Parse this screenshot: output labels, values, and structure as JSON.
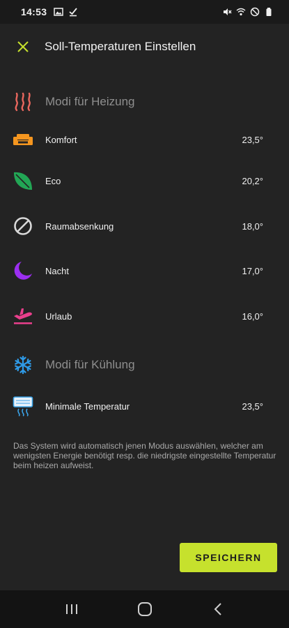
{
  "status_bar": {
    "time": "14:53",
    "left_icons": [
      "image-icon",
      "download-done-icon"
    ],
    "right_icons": [
      "mute-icon",
      "wifi-icon",
      "dnd-icon",
      "battery-icon"
    ]
  },
  "app_bar": {
    "close_icon": "close-icon",
    "title": "Soll-Temperaturen Einstellen"
  },
  "heating": {
    "title": "Modi für Heizung",
    "icon": "heat-waves-icon",
    "items": [
      {
        "label": "Komfort",
        "value": "23,5°",
        "icon": "sofa-icon",
        "color": "#f5961f"
      },
      {
        "label": "Eco",
        "value": "20,2°",
        "icon": "leaf-icon",
        "color": "#22a655"
      },
      {
        "label": "Raumabsenkung",
        "value": "18,0°",
        "icon": "prohibited-icon",
        "color": "#d9d9d9"
      },
      {
        "label": "Nacht",
        "value": "17,0°",
        "icon": "moon-icon",
        "color": "#9b2ff0"
      },
      {
        "label": "Urlaub",
        "value": "16,0°",
        "icon": "plane-departure-icon",
        "color": "#ea3f8c"
      }
    ]
  },
  "cooling": {
    "title": "Modi für Kühlung",
    "icon": "snowflake-icon",
    "items": [
      {
        "label": "Minimale Temperatur",
        "value": "23,5°",
        "icon": "air-conditioner-icon",
        "color": "#3aa3e8"
      }
    ]
  },
  "info_text": "Das System wird automatisch jenen Modus auswählen, welcher am wenigsten Energie benötigt resp. die niedrigste eingestellte Temperatur beim heizen aufweist.",
  "save_label": "SPEICHERN",
  "colors": {
    "background": "#232323",
    "accent": "#c6e12d",
    "heating_header_icon": "#e9675e",
    "cooling_header_icon": "#2f9be8"
  },
  "nav_bar": {
    "items": [
      "recent-apps-icon",
      "home-icon",
      "back-icon"
    ]
  }
}
